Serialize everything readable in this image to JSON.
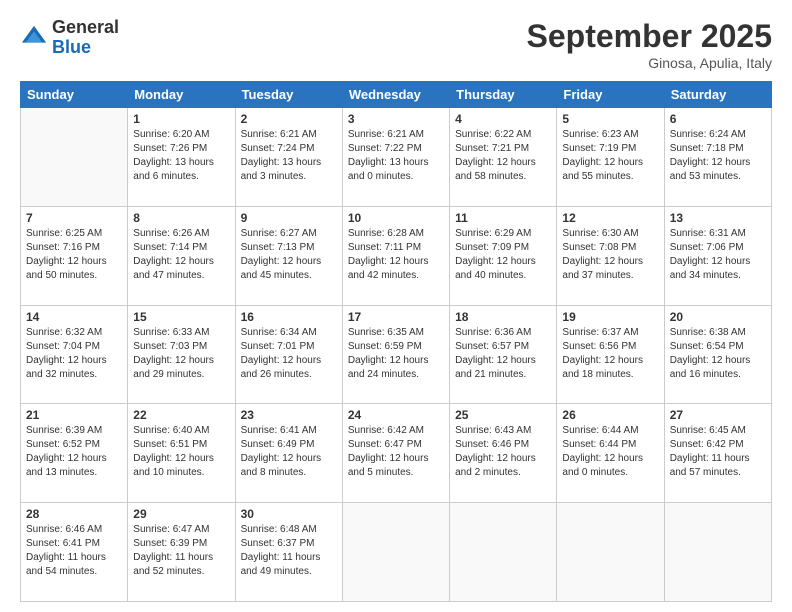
{
  "header": {
    "logo_general": "General",
    "logo_blue": "Blue",
    "month_title": "September 2025",
    "location": "Ginosa, Apulia, Italy"
  },
  "days_of_week": [
    "Sunday",
    "Monday",
    "Tuesday",
    "Wednesday",
    "Thursday",
    "Friday",
    "Saturday"
  ],
  "weeks": [
    [
      {
        "day": "",
        "info": ""
      },
      {
        "day": "1",
        "info": "Sunrise: 6:20 AM\nSunset: 7:26 PM\nDaylight: 13 hours\nand 6 minutes."
      },
      {
        "day": "2",
        "info": "Sunrise: 6:21 AM\nSunset: 7:24 PM\nDaylight: 13 hours\nand 3 minutes."
      },
      {
        "day": "3",
        "info": "Sunrise: 6:21 AM\nSunset: 7:22 PM\nDaylight: 13 hours\nand 0 minutes."
      },
      {
        "day": "4",
        "info": "Sunrise: 6:22 AM\nSunset: 7:21 PM\nDaylight: 12 hours\nand 58 minutes."
      },
      {
        "day": "5",
        "info": "Sunrise: 6:23 AM\nSunset: 7:19 PM\nDaylight: 12 hours\nand 55 minutes."
      },
      {
        "day": "6",
        "info": "Sunrise: 6:24 AM\nSunset: 7:18 PM\nDaylight: 12 hours\nand 53 minutes."
      }
    ],
    [
      {
        "day": "7",
        "info": "Sunrise: 6:25 AM\nSunset: 7:16 PM\nDaylight: 12 hours\nand 50 minutes."
      },
      {
        "day": "8",
        "info": "Sunrise: 6:26 AM\nSunset: 7:14 PM\nDaylight: 12 hours\nand 47 minutes."
      },
      {
        "day": "9",
        "info": "Sunrise: 6:27 AM\nSunset: 7:13 PM\nDaylight: 12 hours\nand 45 minutes."
      },
      {
        "day": "10",
        "info": "Sunrise: 6:28 AM\nSunset: 7:11 PM\nDaylight: 12 hours\nand 42 minutes."
      },
      {
        "day": "11",
        "info": "Sunrise: 6:29 AM\nSunset: 7:09 PM\nDaylight: 12 hours\nand 40 minutes."
      },
      {
        "day": "12",
        "info": "Sunrise: 6:30 AM\nSunset: 7:08 PM\nDaylight: 12 hours\nand 37 minutes."
      },
      {
        "day": "13",
        "info": "Sunrise: 6:31 AM\nSunset: 7:06 PM\nDaylight: 12 hours\nand 34 minutes."
      }
    ],
    [
      {
        "day": "14",
        "info": "Sunrise: 6:32 AM\nSunset: 7:04 PM\nDaylight: 12 hours\nand 32 minutes."
      },
      {
        "day": "15",
        "info": "Sunrise: 6:33 AM\nSunset: 7:03 PM\nDaylight: 12 hours\nand 29 minutes."
      },
      {
        "day": "16",
        "info": "Sunrise: 6:34 AM\nSunset: 7:01 PM\nDaylight: 12 hours\nand 26 minutes."
      },
      {
        "day": "17",
        "info": "Sunrise: 6:35 AM\nSunset: 6:59 PM\nDaylight: 12 hours\nand 24 minutes."
      },
      {
        "day": "18",
        "info": "Sunrise: 6:36 AM\nSunset: 6:57 PM\nDaylight: 12 hours\nand 21 minutes."
      },
      {
        "day": "19",
        "info": "Sunrise: 6:37 AM\nSunset: 6:56 PM\nDaylight: 12 hours\nand 18 minutes."
      },
      {
        "day": "20",
        "info": "Sunrise: 6:38 AM\nSunset: 6:54 PM\nDaylight: 12 hours\nand 16 minutes."
      }
    ],
    [
      {
        "day": "21",
        "info": "Sunrise: 6:39 AM\nSunset: 6:52 PM\nDaylight: 12 hours\nand 13 minutes."
      },
      {
        "day": "22",
        "info": "Sunrise: 6:40 AM\nSunset: 6:51 PM\nDaylight: 12 hours\nand 10 minutes."
      },
      {
        "day": "23",
        "info": "Sunrise: 6:41 AM\nSunset: 6:49 PM\nDaylight: 12 hours\nand 8 minutes."
      },
      {
        "day": "24",
        "info": "Sunrise: 6:42 AM\nSunset: 6:47 PM\nDaylight: 12 hours\nand 5 minutes."
      },
      {
        "day": "25",
        "info": "Sunrise: 6:43 AM\nSunset: 6:46 PM\nDaylight: 12 hours\nand 2 minutes."
      },
      {
        "day": "26",
        "info": "Sunrise: 6:44 AM\nSunset: 6:44 PM\nDaylight: 12 hours\nand 0 minutes."
      },
      {
        "day": "27",
        "info": "Sunrise: 6:45 AM\nSunset: 6:42 PM\nDaylight: 11 hours\nand 57 minutes."
      }
    ],
    [
      {
        "day": "28",
        "info": "Sunrise: 6:46 AM\nSunset: 6:41 PM\nDaylight: 11 hours\nand 54 minutes."
      },
      {
        "day": "29",
        "info": "Sunrise: 6:47 AM\nSunset: 6:39 PM\nDaylight: 11 hours\nand 52 minutes."
      },
      {
        "day": "30",
        "info": "Sunrise: 6:48 AM\nSunset: 6:37 PM\nDaylight: 11 hours\nand 49 minutes."
      },
      {
        "day": "",
        "info": ""
      },
      {
        "day": "",
        "info": ""
      },
      {
        "day": "",
        "info": ""
      },
      {
        "day": "",
        "info": ""
      }
    ]
  ]
}
